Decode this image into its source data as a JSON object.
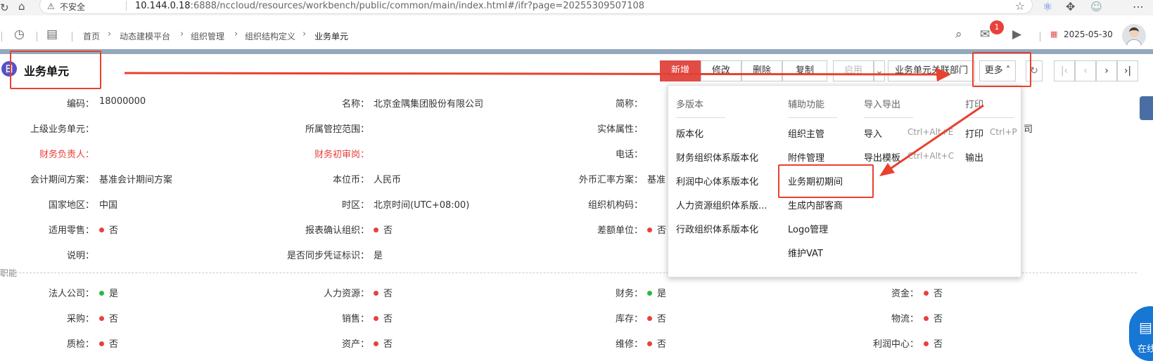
{
  "browser": {
    "insecure_label": "不安全",
    "url_host": "10.144.0.18",
    "url_path": ":6888/nccloud/resources/workbench/public/common/main/index.html#/ifr?page=20255309507108"
  },
  "appbar": {
    "breadcrumbs": [
      "首页",
      "动态建模平台",
      "组织管理",
      "组织结构定义",
      "业务单元"
    ],
    "notification_count": "1",
    "date": "2025-05-30"
  },
  "page": {
    "title": "业务单元",
    "title_icon": "日"
  },
  "toolbar": {
    "add": "新增",
    "edit": "修改",
    "delete": "删除",
    "copy": "复制",
    "enable": "启用",
    "dept_link": "业务单元关联部门",
    "more": "更多 ˄"
  },
  "form": {
    "row1": {
      "code_label": "编码：",
      "code_value": "18000000",
      "name_label": "名称：",
      "name_value": "北京金隅集团股份有限公司",
      "short_label": "简称："
    },
    "row2": {
      "parent_label": "上级业务单元：",
      "scope_label": "所属管控范围：",
      "entity_label": "实体属性：",
      "tail": "司"
    },
    "row3": {
      "fin_head_label": "财务负责人：",
      "fin_review_label": "财务初审岗：",
      "phone_label": "电话："
    },
    "row4": {
      "period_label": "会计期间方案：",
      "period_value": "基准会计期间方案",
      "currency_label": "本位币：",
      "currency_value": "人民币",
      "fx_label": "外币汇率方案：",
      "fx_value": "基准"
    },
    "row5": {
      "country_label": "国家地区：",
      "country_value": "中国",
      "tz_label": "时区：",
      "tz_value": "北京时间(UTC+08:00)",
      "orgcode_label": "组织机构码："
    },
    "row6": {
      "retail_label": "适用零售：",
      "retail_value": "否",
      "report_label": "报表确认组织：",
      "report_value": "否",
      "diff_label": "差额单位：",
      "diff_value": "否"
    },
    "row7": {
      "desc_label": "说明：",
      "sync_label": "是否同步凭证标识：",
      "sync_value": "是"
    },
    "section_label": "职能",
    "row8": {
      "legal_label": "法人公司：",
      "legal_value": "是",
      "hr_label": "人力资源：",
      "hr_value": "否",
      "finance_label": "财务：",
      "finance_value": "是",
      "fund_label": "资金：",
      "fund_value": "否"
    },
    "row9": {
      "purchase_label": "采购：",
      "purchase_value": "否",
      "sales_label": "销售：",
      "sales_value": "否",
      "stock_label": "库存：",
      "stock_value": "否",
      "logistics_label": "物流：",
      "logistics_value": "否"
    },
    "row10": {
      "qc_label": "质检：",
      "qc_value": "否",
      "asset_label": "资产：",
      "asset_value": "否",
      "repair_label": "维修：",
      "repair_value": "否",
      "profit_label": "利润中心：",
      "profit_value": "否"
    }
  },
  "more_menu": {
    "col1": {
      "header": "多版本",
      "items": [
        "版本化",
        "财务组织体系版本化",
        "利润中心体系版本化",
        "人力资源组织体系版...",
        "行政组织体系版本化"
      ]
    },
    "col2": {
      "header": "辅助功能",
      "items": [
        "组织主管",
        "附件管理",
        "业务期初期间",
        "生成内部客商",
        "Logo管理",
        "维护VAT"
      ]
    },
    "col3": {
      "header": "导入导出",
      "items": [
        "导入",
        "导出模板"
      ],
      "shortcuts": [
        "Ctrl+Alt+E",
        "Ctrl+Alt+C"
      ]
    },
    "col4": {
      "header": "打印",
      "items": [
        "打印",
        "输出"
      ],
      "shortcuts": [
        "Ctrl+P"
      ]
    }
  },
  "side": {
    "chat_label": "在线"
  },
  "colors": {
    "primary": "#e14c46",
    "annotation": "#e8412e",
    "no_dot": "#e8413b",
    "yes_dot": "#2db742",
    "accent_bar": "#93a8bd"
  }
}
